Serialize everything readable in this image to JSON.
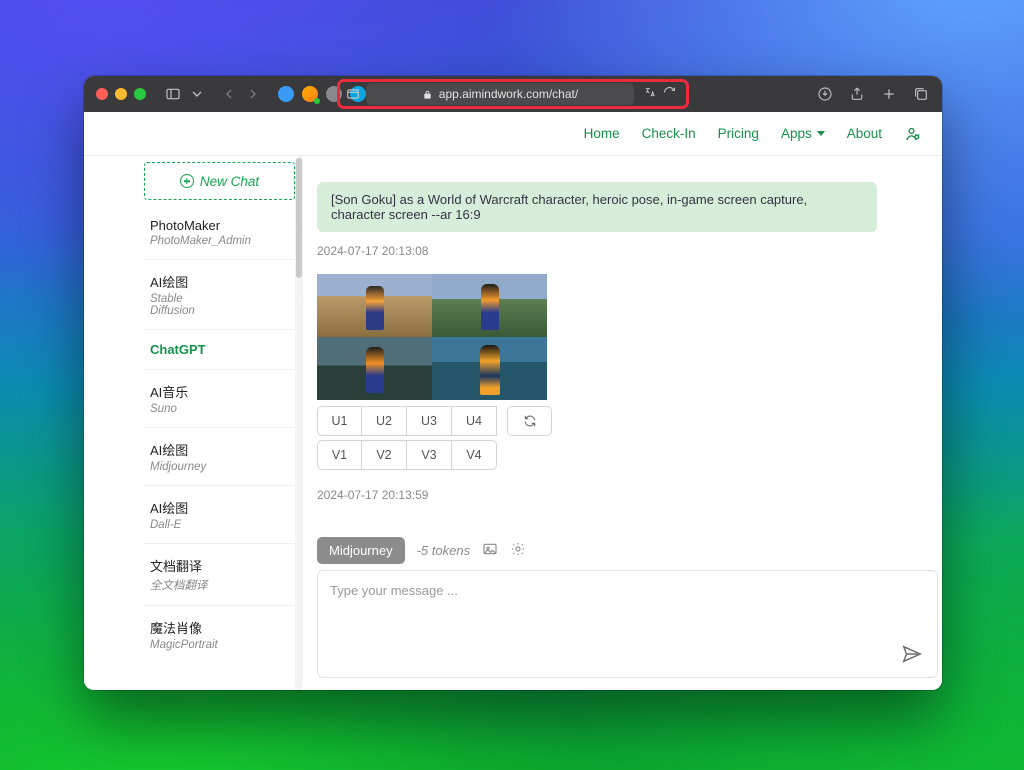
{
  "browser": {
    "url_display": "app.aimindwork.com/chat/"
  },
  "nav": {
    "home": "Home",
    "checkin": "Check-In",
    "pricing": "Pricing",
    "apps": "Apps",
    "about": "About"
  },
  "sidebar": {
    "newchat": "New Chat",
    "items": [
      {
        "title": "PhotoMaker",
        "subtitle": "PhotoMaker_Admin"
      },
      {
        "title": "AI绘图",
        "subtitle": "Stable\nDiffusion"
      },
      {
        "title": "ChatGPT",
        "subtitle": ""
      },
      {
        "title": "AI音乐",
        "subtitle": "Suno"
      },
      {
        "title": "AI绘图",
        "subtitle": "Midjourney"
      },
      {
        "title": "AI绘图",
        "subtitle": "Dall-E"
      },
      {
        "title": "文档翻译",
        "subtitle": "全文档翻译"
      },
      {
        "title": "魔法肖像",
        "subtitle": "MagicPortrait"
      }
    ],
    "active_index": 2
  },
  "chat": {
    "user_message": "[Son Goku] as a World of Warcraft character, heroic pose, in-game screen capture, character screen --ar 16:9",
    "ts1": "2024-07-17 20:13:08",
    "ts2": "2024-07-17 20:13:59",
    "u_buttons": [
      "U1",
      "U2",
      "U3",
      "U4"
    ],
    "v_buttons": [
      "V1",
      "V2",
      "V3",
      "V4"
    ]
  },
  "composer": {
    "chip": "Midjourney",
    "tokens": "-5 tokens",
    "placeholder": "Type your message ..."
  }
}
